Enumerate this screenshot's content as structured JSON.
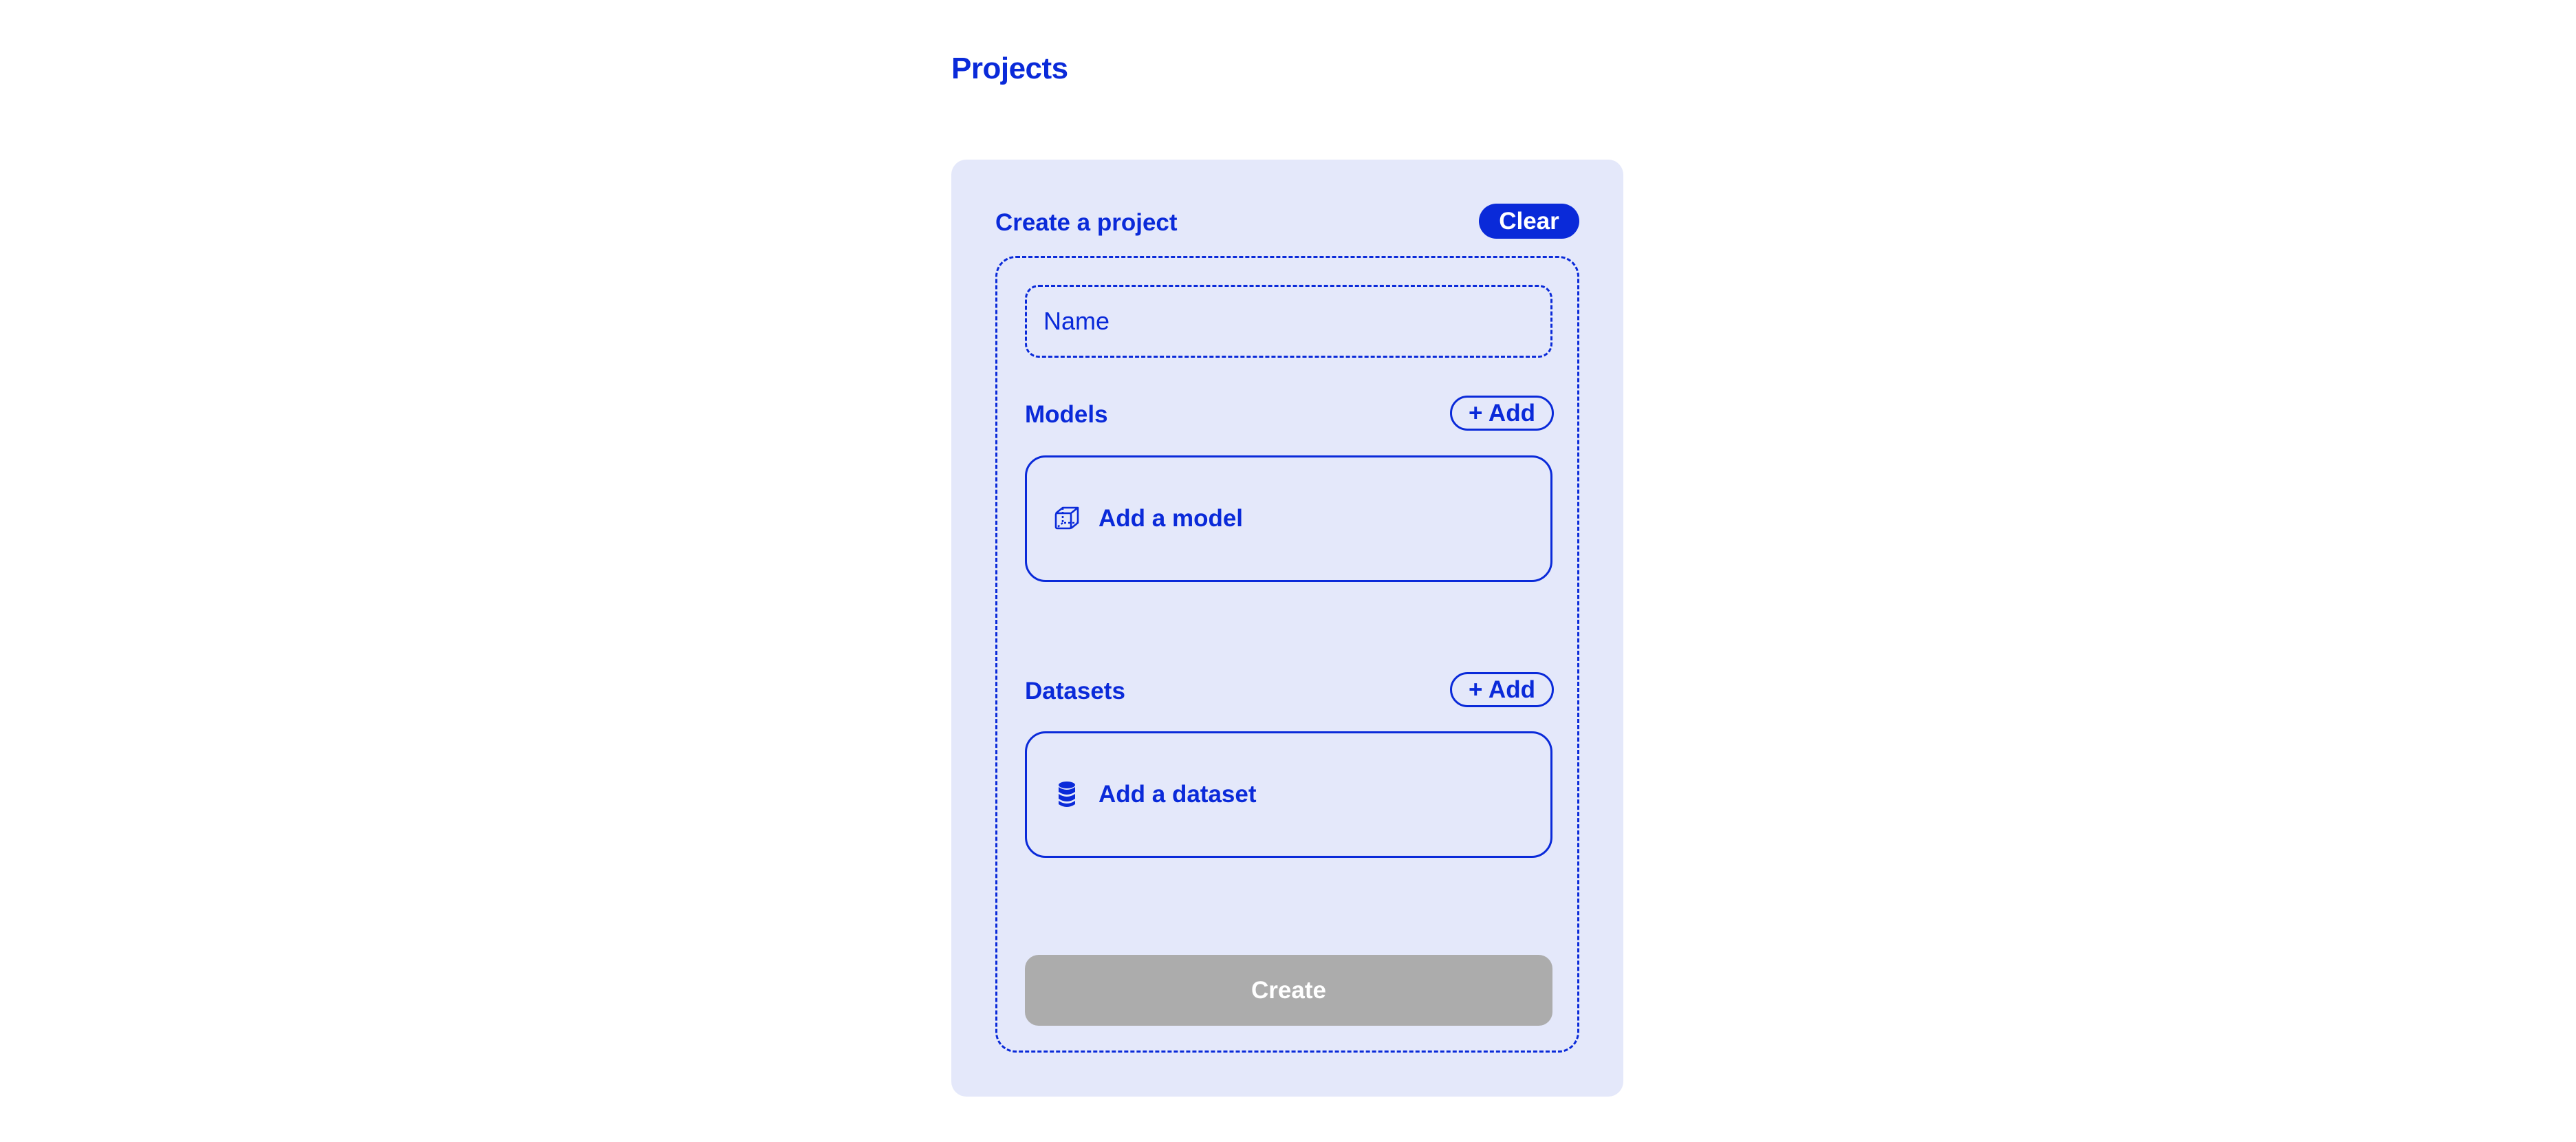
{
  "page": {
    "title": "Projects"
  },
  "create_project": {
    "title": "Create a project",
    "clear_label": "Clear",
    "name_field": {
      "placeholder": "Name",
      "value": ""
    },
    "models": {
      "label": "Models",
      "add_label": "+ Add",
      "empty_label": "Add a model",
      "icon": "cube-icon"
    },
    "datasets": {
      "label": "Datasets",
      "add_label": "+ Add",
      "empty_label": "Add a dataset",
      "icon": "database-icon"
    },
    "create_label": "Create",
    "create_enabled": false
  },
  "colors": {
    "accent": "#0a2ad9",
    "card_background": "#e4e8fa",
    "disabled_button": "#acacac",
    "page_background": "#ffffff"
  }
}
